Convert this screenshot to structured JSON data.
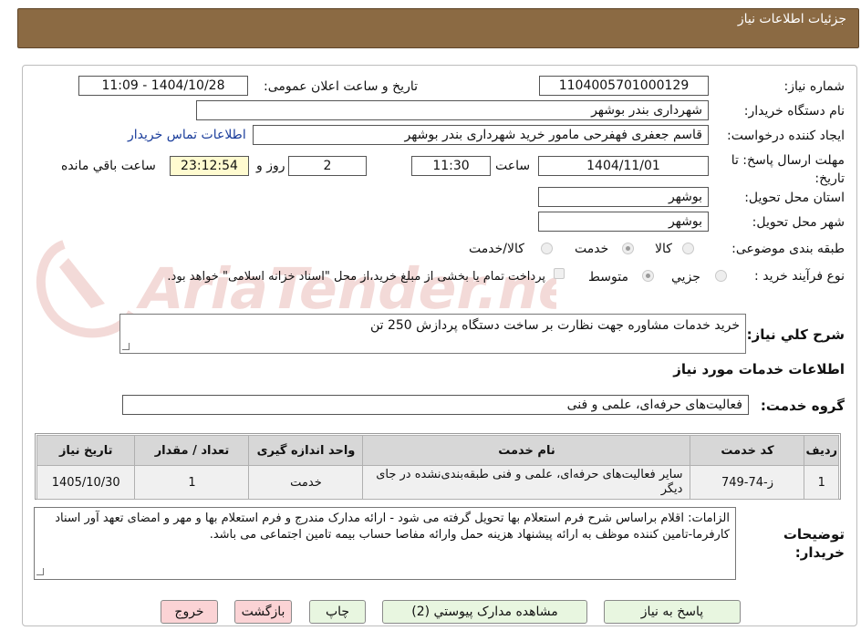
{
  "header": {
    "title": "جزئیات اطلاعات نیاز"
  },
  "form": {
    "need_number_label": "شماره نیاز:",
    "need_number": "1104005701000129",
    "announce_label": "تاریخ و ساعت اعلان عمومی:",
    "announce_value": "1404/10/28 - 11:09",
    "buyer_label": "نام دستگاه خریدار:",
    "buyer_value": "شهرداری بندر بوشهر",
    "creator_label": "ایجاد کننده درخواست:",
    "creator_value": "قاسم جعفری فهفرحی مامور خرید  شهرداری بندر بوشهر",
    "contact_link": "اطلاعات تماس خریدار",
    "deadline_label": "مهلت ارسال پاسخ: تا تاریخ:",
    "deadline_date": "1404/11/01",
    "time_label": "ساعت",
    "deadline_time": "11:30",
    "days_value": "2",
    "days_label": "روز و",
    "remaining_value": "23:12:54",
    "remaining_label": "ساعت باقي مانده",
    "province_label": "استان محل تحویل:",
    "province_value": "بوشهر",
    "city_label": "شهر محل تحویل:",
    "city_value": "بوشهر",
    "category_label": "طبقه بندی موضوعی:",
    "category_options": [
      "کالا",
      "خدمت",
      "کالا/خدمت"
    ],
    "category_selected": "خدمت",
    "process_label": "نوع فرآیند خرید :",
    "process_options": [
      "جزيي",
      "متوسط"
    ],
    "process_selected": "متوسط",
    "payment_note": "پرداخت تمام یا بخشی از مبلغ خرید،از محل \"اسناد خزانه اسلامی\" خواهد بود."
  },
  "description": {
    "label": "شرح کلي نیاز:",
    "value": "خرید خدمات مشاوره جهت نظارت بر ساخت دستگاه پردازش 250 تن"
  },
  "services": {
    "section_title": "اطلاعات خدمات مورد نیاز",
    "group_label": "گروه خدمت:",
    "group_value": "فعالیت‌های حرفه‌ای، علمی و فنی",
    "columns": [
      "ردیف",
      "کد خدمت",
      "نام خدمت",
      "واحد اندازه گیری",
      "تعداد / مقدار",
      "تاریخ نیاز"
    ],
    "rows": [
      {
        "row": "1",
        "code": "ز-74-749",
        "name": "سایر فعالیت‌های حرفه‌ای، علمی و فنی طبقه‌بندی‌نشده در جای دیگر",
        "unit": "خدمت",
        "qty": "1",
        "date": "1405/10/30"
      }
    ]
  },
  "buyer_notes": {
    "label": "توضیحات خریدار:",
    "value": "الزامات: اقلام براساس شرح فرم استعلام بها تحویل گرفته می شود - ارائه مدارک مندرج و فرم استعلام بها و مهر و امضای تعهد آور اسناد کارفرما-تامین کننده موظف به ارائه پیشنهاد هزینه حمل وارائه مفاصا حساب بیمه تامین اجتماعی می باشد."
  },
  "buttons": {
    "reply": "پاسخ به نیاز",
    "attachments": "مشاهده مدارک پیوستي (2)",
    "print": "چاپ",
    "back": "بازگشت",
    "exit": "خروج"
  },
  "watermark": {
    "text": "AriaTender.neT"
  },
  "colors": {
    "header_bg": "#8b6a43",
    "table_head": "#d7d7d7",
    "btn_green": "#e8f6e0",
    "btn_pink": "#fbd3d5",
    "link": "#1a3d9b"
  }
}
